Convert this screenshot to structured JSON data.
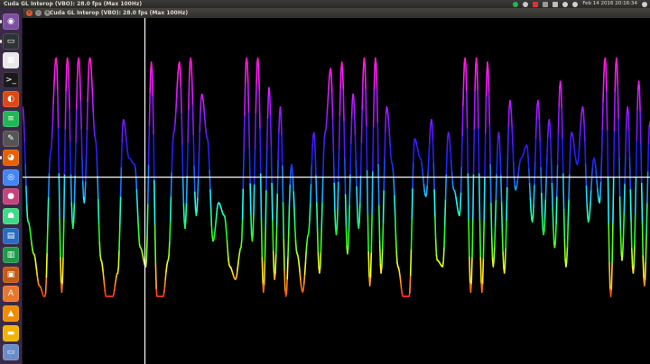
{
  "top_panel": {
    "window_title": "Cuda GL Interop (VBO): 28.0 fps (Max 100Hz)",
    "clock": "Feb 14 2016 20:16:34",
    "tray_icons": [
      "spotify-icon",
      "audio-icon",
      "notification-icon",
      "battery-icon",
      "keyboard-icon",
      "wifi-icon",
      "volume-icon",
      "power-icon"
    ]
  },
  "launcher": [
    {
      "name": "dash-icon",
      "glyph": "◉",
      "color": "#7e4ea3"
    },
    {
      "name": "terminal-icon",
      "glyph": "▭",
      "color": "#2e3436"
    },
    {
      "name": "calendar-icon",
      "glyph": "▦",
      "color": "#e8e8e8"
    },
    {
      "name": "terminal-dark-icon",
      "glyph": ">_",
      "color": "#1a1a1a"
    },
    {
      "name": "ubuntu-software-icon",
      "glyph": "◐",
      "color": "#dd4814"
    },
    {
      "name": "spotify-icon",
      "glyph": "≡",
      "color": "#1db954"
    },
    {
      "name": "gnome-tweak-icon",
      "glyph": "✎",
      "color": "#555"
    },
    {
      "name": "firefox-icon",
      "glyph": "◕",
      "color": "#e66000"
    },
    {
      "name": "chrome-icon",
      "glyph": "◎",
      "color": "#4285f4"
    },
    {
      "name": "media-player-icon",
      "glyph": "●",
      "color": "#c4447c"
    },
    {
      "name": "android-icon",
      "glyph": "☗",
      "color": "#3ddc84"
    },
    {
      "name": "writer-icon",
      "glyph": "▤",
      "color": "#2a6cc1"
    },
    {
      "name": "calc-icon",
      "glyph": "▥",
      "color": "#1e9a47"
    },
    {
      "name": "impress-icon",
      "glyph": "▣",
      "color": "#c55a11"
    },
    {
      "name": "font-icon",
      "glyph": "A",
      "color": "#e8762d"
    },
    {
      "name": "vlc-icon",
      "glyph": "▲",
      "color": "#f08c00"
    },
    {
      "name": "archive-icon",
      "glyph": "▬",
      "color": "#f0b400"
    },
    {
      "name": "files-icon",
      "glyph": "▭",
      "color": "#6a8cc8"
    }
  ],
  "window": {
    "caption": "Cuda GL Interop (VBO): 28.0 fps (Max 100Hz)",
    "buttons": {
      "close": "×",
      "minimize": "–",
      "maximize": "+"
    }
  },
  "plot": {
    "background": "#000000",
    "axis_color": "#ffffff",
    "vertical_cursor_x_fraction": 0.195,
    "horizontal_axis_y_fraction": 0.46,
    "color_scale": "rainbow by amplitude (magenta high, blue/cyan mid, green/yellow low, red lowest)",
    "waveform_amplitudes": [
      0.55,
      -0.35,
      -0.6,
      -0.85,
      -0.95,
      0.2,
      0.95,
      -0.9,
      0.95,
      -0.4,
      0.95,
      -0.2,
      0.95,
      0.3,
      -0.65,
      -0.95,
      -0.95,
      -0.75,
      0.45,
      0.15,
      0.1,
      -0.55,
      -0.7,
      0.9,
      -0.95,
      -0.95,
      -0.65,
      0.35,
      0.9,
      -0.4,
      0.95,
      -0.3,
      0.65,
      0.3,
      -0.5,
      -0.2,
      -0.3,
      -0.7,
      -0.8,
      -0.55,
      0.95,
      -0.5,
      0.95,
      -0.9,
      0.7,
      -0.8,
      0.55,
      -0.95,
      0.1,
      -0.6,
      -0.9,
      -0.45,
      0.35,
      -0.75,
      0.35,
      0.85,
      -0.45,
      0.9,
      -0.6,
      0.65,
      -0.4,
      0.95,
      -0.85,
      0.95,
      -0.75,
      0.55,
      0.1,
      -0.7,
      -0.95,
      -0.95,
      0.3,
      0.15,
      -0.15,
      0.45,
      -0.65,
      -0.7,
      0.35,
      -0.1,
      -0.3,
      0.95,
      -0.9,
      0.95,
      -0.9,
      0.9,
      -0.7,
      0.35,
      -0.75,
      0.6,
      -0.1,
      0.15,
      0.25,
      -0.35,
      0.6,
      -0.45,
      0.45,
      -0.55,
      0.75,
      -0.7,
      0.35,
      0.1,
      0.55,
      -0.35,
      0.15,
      -0.2,
      0.95,
      -0.95,
      0.95,
      -0.65,
      0.55,
      -0.75,
      0.75,
      -0.85,
      0.45
    ]
  }
}
